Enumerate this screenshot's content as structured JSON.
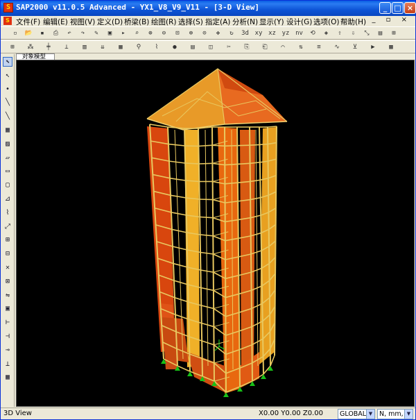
{
  "window": {
    "title": "SAP2000 v11.0.5 Advanced  - YX1_V8_V9_V11 - [3-D View]",
    "app_icon_glyph": "S"
  },
  "menu": {
    "items": [
      "文件(F)",
      "编辑(E)",
      "视图(V)",
      "定义(D)",
      "桥梁(B)",
      "绘图(R)",
      "选择(S)",
      "指定(A)",
      "分析(N)",
      "显示(Y)",
      "设计(G)",
      "选项(O)",
      "帮助(H)"
    ],
    "mdi_controls": "_ ▫ ×"
  },
  "toolbar1": {
    "tools": [
      "new-icon",
      "open-icon",
      "save-icon",
      "print-icon",
      "undo-icon",
      "redo-icon",
      "pencil-icon",
      "lock-icon",
      "run-icon",
      "zoom-window-icon",
      "zoom-in-icon",
      "zoom-out-icon",
      "zoom-all-icon",
      "zoom-prev-icon",
      "zoom-step-icon",
      "pan-icon",
      "refresh-icon",
      "3d-view-icon",
      "xy-view-icon",
      "xz-view-icon",
      "yz-view-icon",
      "nv-view-icon",
      "rotate-icon",
      "perspective-icon",
      "move-up-icon",
      "move-down-icon",
      "shrink-icon",
      "set-display-icon",
      "extrude-icon"
    ],
    "labels": {
      "3d": "3d",
      "xy": "xy",
      "xz": "xz",
      "yz": "yz",
      "nv": "nv"
    }
  },
  "toolbar2": {
    "tools": [
      "grid-icon",
      "joint-icon",
      "frame-icon",
      "restraint-icon",
      "section-icon",
      "load-icon",
      "area-icon",
      "link-icon",
      "spring-icon",
      "mass-icon",
      "table-icon",
      "release-icon",
      "cut-icon",
      "copy-icon",
      "paste-icon",
      "deformed-icon",
      "force-icon",
      "stress-icon",
      "moment-icon",
      "reaction-icon",
      "animate-icon",
      "design-icon"
    ]
  },
  "palette": {
    "tools": [
      "pointer-icon",
      "reshape-icon",
      "draw-joint-icon",
      "draw-frame-icon",
      "draw-line-icon",
      "quick-frame-icon",
      "draw-brace-icon",
      "draw-area-icon",
      "draw-rect-icon",
      "draw-quad-icon",
      "draw-link-icon",
      "draw-tendon-icon",
      "draw-section-icon",
      "select-all-icon",
      "select-prev-icon",
      "clear-select-icon",
      "intersect-icon",
      "select-line-icon",
      "snap-point-icon",
      "snap-end-icon",
      "snap-mid-icon",
      "snap-intersect-icon",
      "snap-perp-icon",
      "snap-grid-icon"
    ]
  },
  "view": {
    "tab_label": "对象模型"
  },
  "status": {
    "left_text": "3D View",
    "coords": "X0.00  Y0.00  Z0.00",
    "coordinate_system": "GLOBAL",
    "units": "N, mm, C"
  },
  "colors": {
    "title_bar": "#0A5FE3",
    "canvas_background": "#000000",
    "frame_yellow": "#E8C860",
    "shell_orange": "#E86A18",
    "shell_deep": "#D04A10",
    "roof_amber": "#E8A030",
    "support_green": "#18C018"
  }
}
